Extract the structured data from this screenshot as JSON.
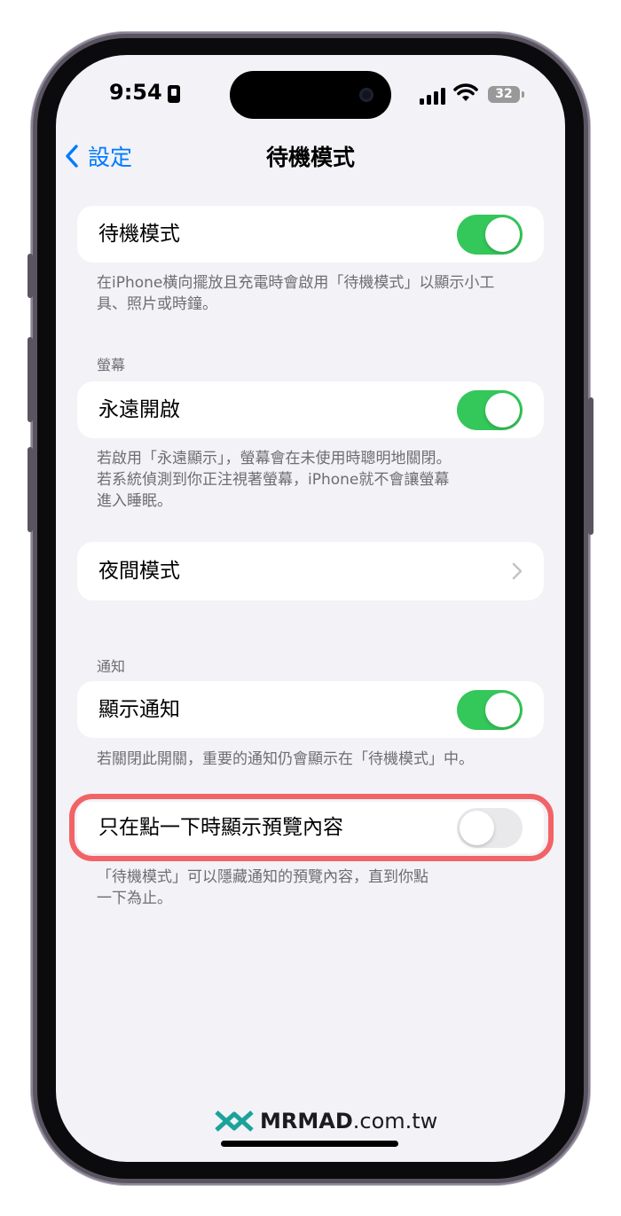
{
  "status_bar": {
    "time": "9:54",
    "battery": "32"
  },
  "nav": {
    "back_label": "設定",
    "title": "待機模式"
  },
  "standby": {
    "label": "待機模式",
    "enabled": true,
    "footnote": "在iPhone橫向擺放且充電時會啟用「待機模式」以顯示小工具、照片或時鐘。"
  },
  "display": {
    "header": "螢幕",
    "always_on_label": "永遠開啟",
    "always_on_enabled": true,
    "footnote_line1": "若啟用「永遠顯示」，螢幕會在未使用時聰明地關閉。",
    "footnote_line2": "若系統偵測到你正注視著螢幕，iPhone就不會讓螢幕",
    "footnote_line3": "進入睡眠。"
  },
  "night_mode": {
    "label": "夜間模式"
  },
  "notifications": {
    "header": "通知",
    "show_label": "顯示通知",
    "show_enabled": true,
    "show_footnote": "若關閉此開關，重要的通知仍會顯示在「待機模式」中。",
    "preview_label": "只在點一下時顯示預覽內容",
    "preview_enabled": false,
    "preview_footnote_line1": "「待機模式」可以隱藏通知的預覽內容，直到你點",
    "preview_footnote_line2": "一下為止。"
  },
  "watermark": {
    "brand": "MRMAD",
    "domain": ".com.tw"
  },
  "colors": {
    "accent": "#007aff",
    "toggle_on": "#34c759",
    "highlight": "#f26366"
  }
}
